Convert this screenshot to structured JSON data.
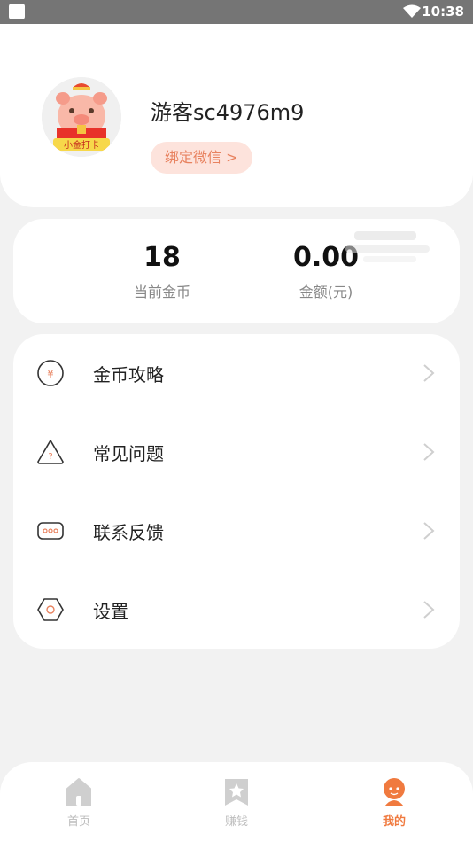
{
  "status_bar": {
    "time": "10:38"
  },
  "profile": {
    "username": "游客sc4976m9",
    "bind_button": "绑定微信 >",
    "avatar_text": "小金打卡"
  },
  "stats": {
    "coins": {
      "value": "18",
      "label": "当前金币"
    },
    "money": {
      "value": "0.00",
      "label": "金额(元)"
    }
  },
  "menu": {
    "items": [
      {
        "label": "金币攻略",
        "icon": "coin-icon"
      },
      {
        "label": "常见问题",
        "icon": "question-icon"
      },
      {
        "label": "联系反馈",
        "icon": "feedback-icon"
      },
      {
        "label": "设置",
        "icon": "settings-icon"
      }
    ]
  },
  "tabbar": {
    "tabs": [
      {
        "label": "首页",
        "icon": "home-icon"
      },
      {
        "label": "赚钱",
        "icon": "star-bookmark-icon"
      },
      {
        "label": "我的",
        "icon": "profile-icon"
      }
    ],
    "active_index": 2
  },
  "colors": {
    "accent": "#f07a3f",
    "bind_bg": "#fde3dc",
    "bind_text": "#e8825f",
    "inactive_tab": "#bdbdbd"
  }
}
